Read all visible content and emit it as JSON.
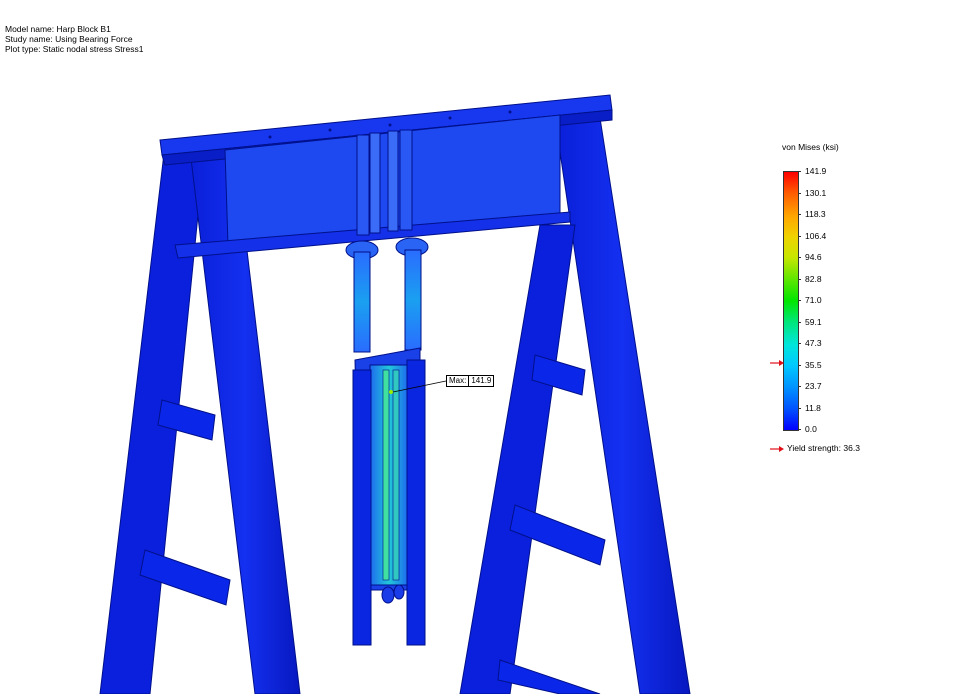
{
  "header": {
    "model_name": "Model name: Harp Block B1",
    "study_name": "Study name: Using Bearing Force",
    "plot_type": "Plot type: Static nodal stress Stress1"
  },
  "legend": {
    "title": "von Mises (ksi)",
    "ticks": [
      "141.9",
      "130.1",
      "118.3",
      "106.4",
      "94.6",
      "82.8",
      "71.0",
      "59.1",
      "47.3",
      "35.5",
      "23.7",
      "11.8",
      "0.0"
    ],
    "yield_label": "Yield strength: 36.3",
    "yield_value": 36.3,
    "max_value": 141.9,
    "colors": {
      "max": "#ff0000",
      "min": "#0000ff",
      "arrow": "#e0101a"
    }
  },
  "callout": {
    "label": "Max:",
    "value": "141.9"
  },
  "model": {
    "base_color": "#0a22e6",
    "edge_color": "#00108a"
  }
}
